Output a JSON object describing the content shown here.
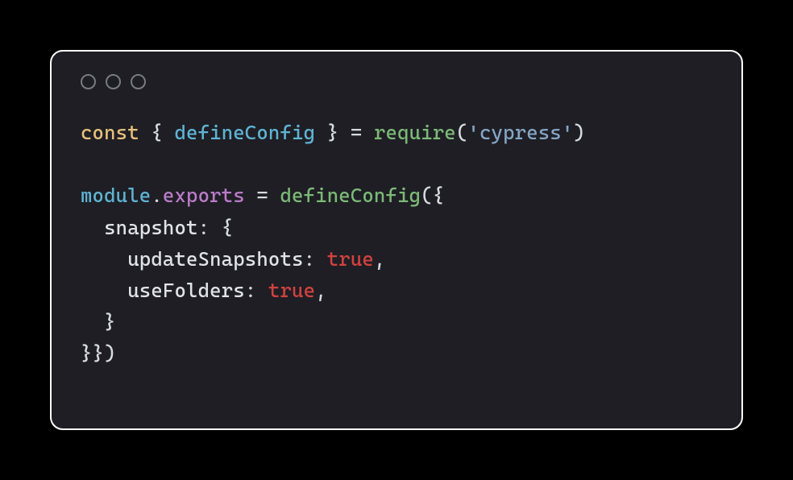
{
  "code": {
    "line1": {
      "const": "const",
      "sp1": " ",
      "brace_open": "{",
      "sp2": " ",
      "defineConfig": "defineConfig",
      "sp3": " ",
      "brace_close": "}",
      "sp4": " ",
      "equals": "=",
      "sp5": " ",
      "require": "require",
      "paren_open": "(",
      "quote1": "'",
      "cypress": "cypress",
      "quote2": "'",
      "paren_close": ")"
    },
    "blank": "",
    "line3": {
      "module": "module",
      "dot": ".",
      "exports": "exports",
      "sp1": " ",
      "equals": "=",
      "sp2": " ",
      "defineConfig": "defineConfig",
      "paren_open": "(",
      "brace_open": "{"
    },
    "line4": {
      "indent": "  ",
      "snapshot": "snapshot",
      "colon": ":",
      "sp": " ",
      "brace_open": "{"
    },
    "line5": {
      "indent": "    ",
      "key": "updateSnapshots",
      "colon": ":",
      "sp": " ",
      "val": "true",
      "comma": ","
    },
    "line6": {
      "indent": "    ",
      "key": "useFolders",
      "colon": ":",
      "sp": " ",
      "val": "true",
      "comma": ","
    },
    "line7": {
      "indent": "  ",
      "brace_close": "}"
    },
    "line8": {
      "brace_close1": "}",
      "brace_close2": "}",
      "paren_close": ")"
    }
  }
}
